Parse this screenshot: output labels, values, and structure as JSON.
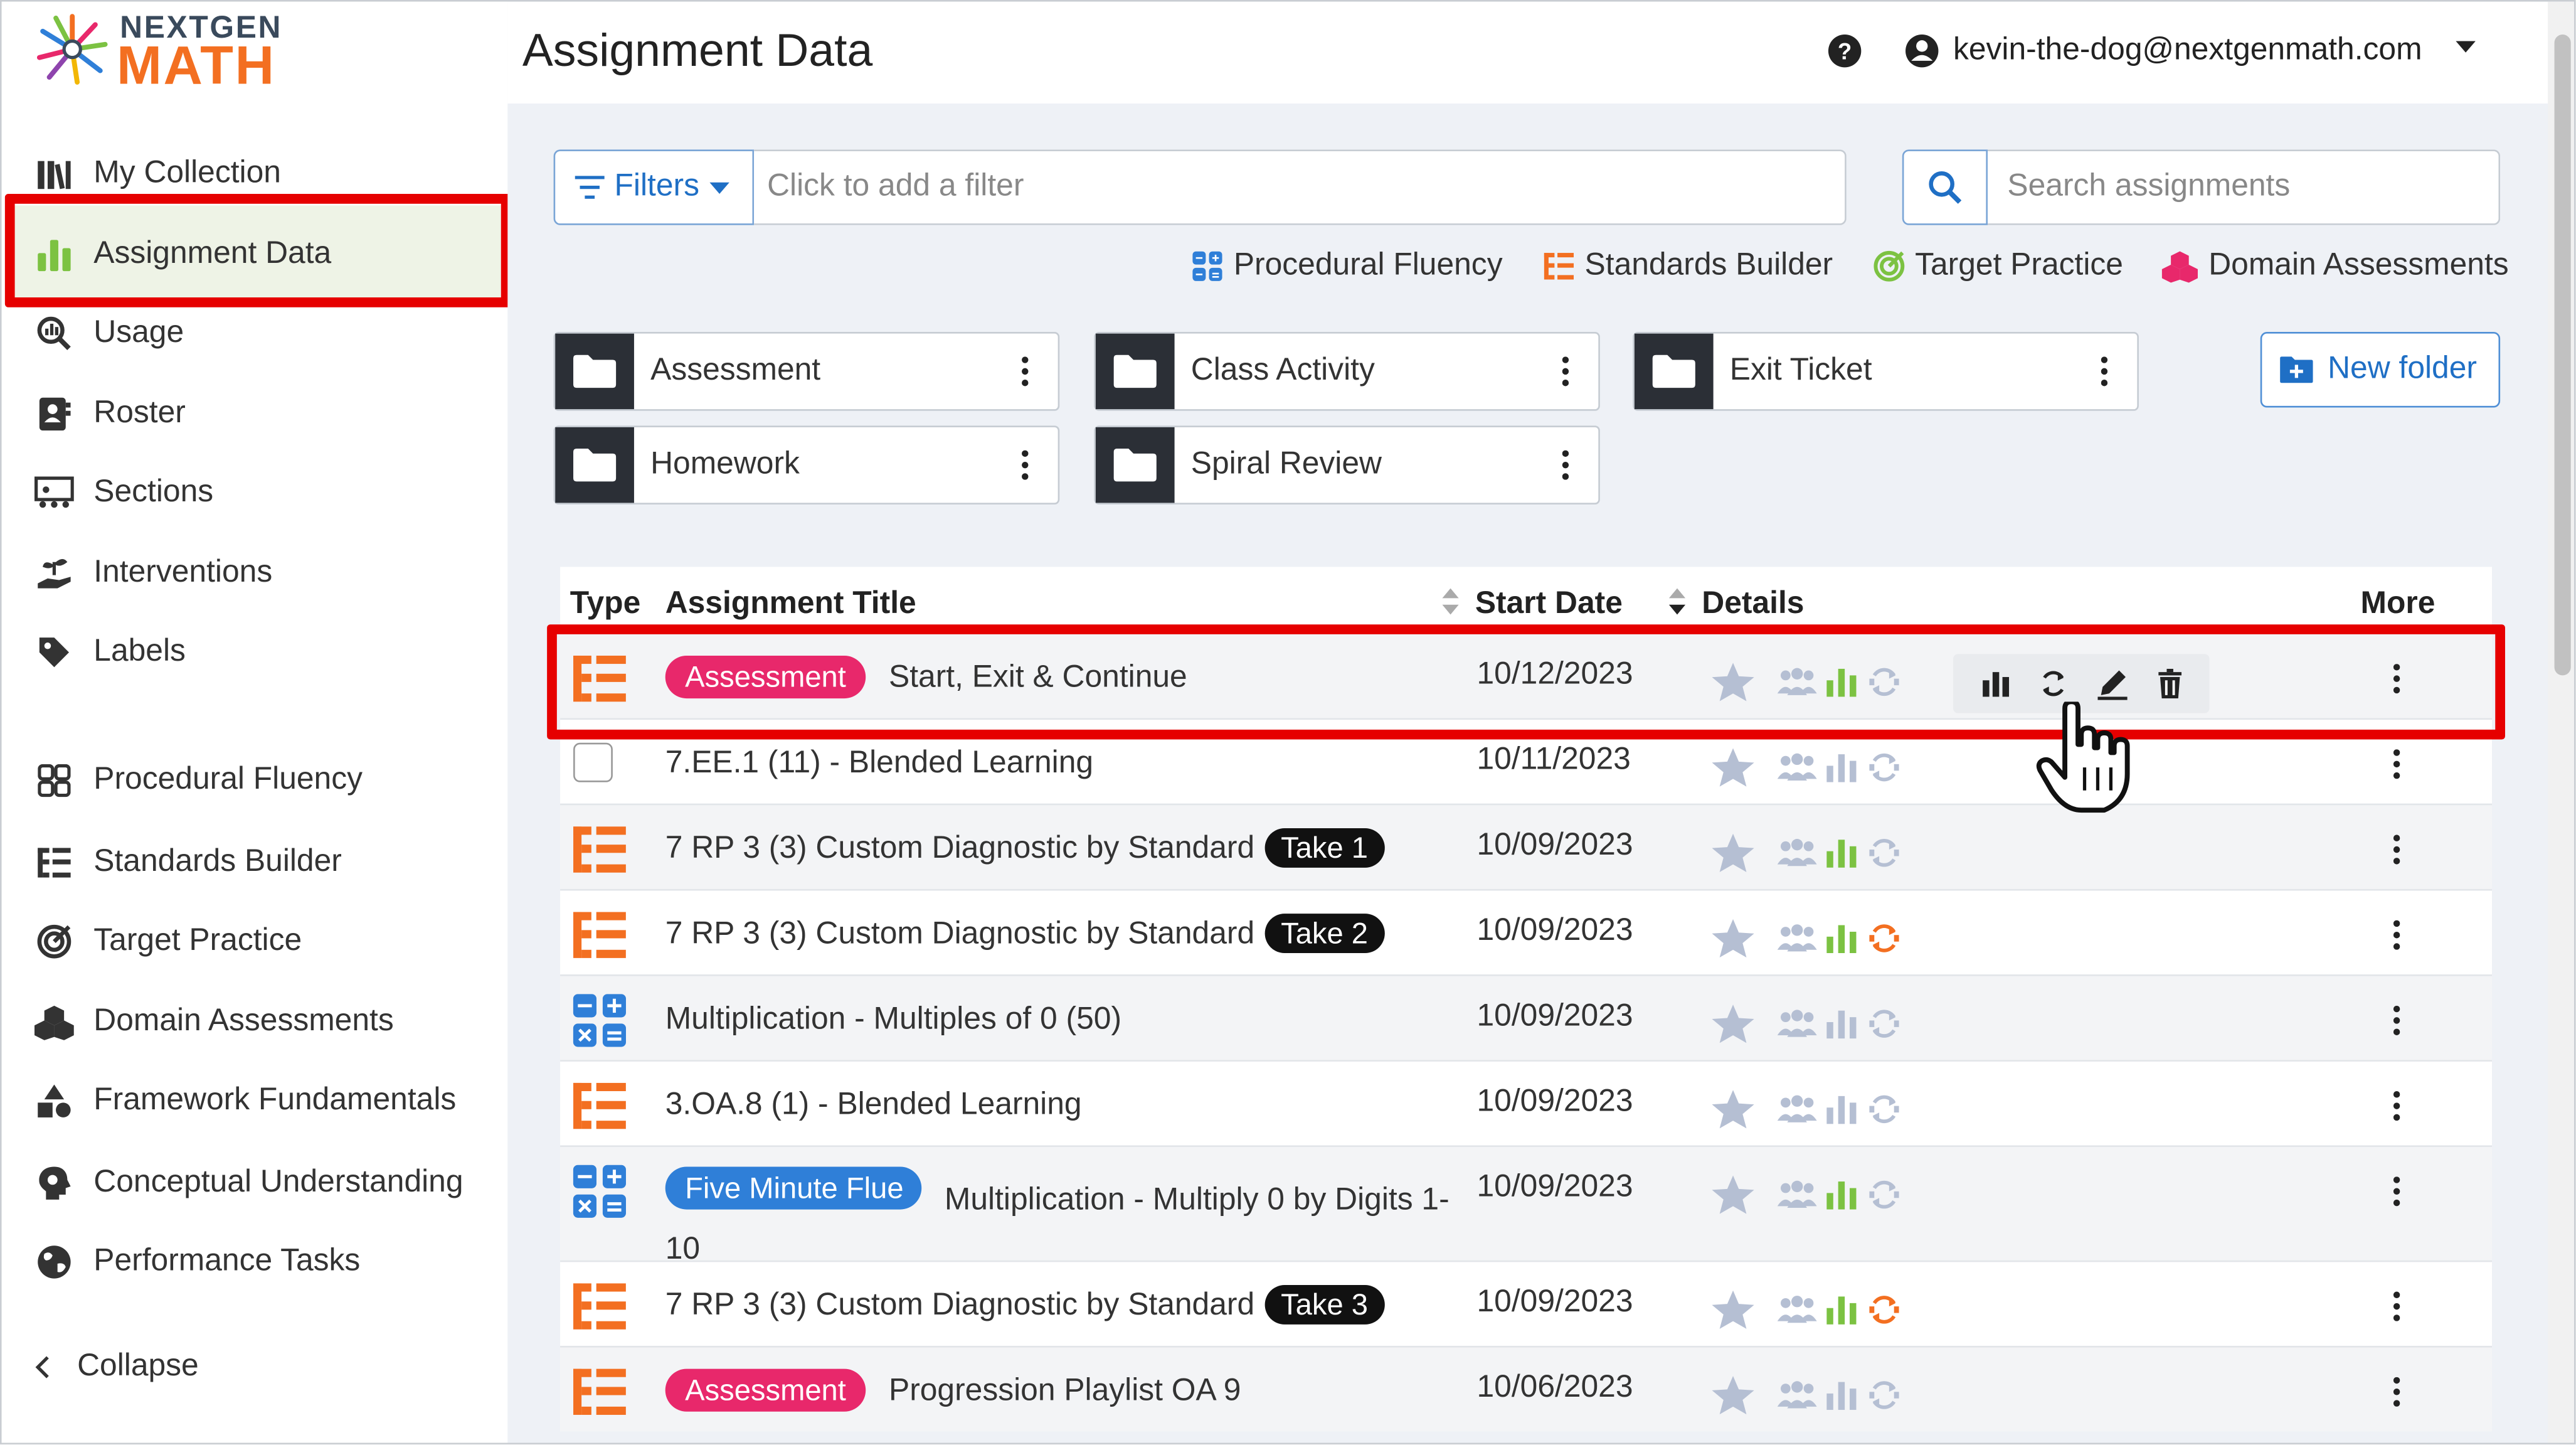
{
  "brand": {
    "line1": "NEXTGEN",
    "line2": "MATH"
  },
  "sidebar": {
    "items": [
      {
        "label": "My Collection",
        "icon": "books-icon"
      },
      {
        "label": "Assignment Data",
        "icon": "bar-chart-icon",
        "active": true
      },
      {
        "label": "Usage",
        "icon": "magnify-chart-icon"
      },
      {
        "label": "Roster",
        "icon": "roster-icon"
      },
      {
        "label": "Sections",
        "icon": "sections-icon"
      },
      {
        "label": "Interventions",
        "icon": "hand-plant-icon"
      },
      {
        "label": "Labels",
        "icon": "tag-icon"
      },
      {
        "label": "Procedural Fluency",
        "icon": "calculator-icon"
      },
      {
        "label": "Standards Builder",
        "icon": "list-tree-icon"
      },
      {
        "label": "Target Practice",
        "icon": "target-icon"
      },
      {
        "label": "Domain Assessments",
        "icon": "cubes-icon"
      },
      {
        "label": "Framework Fundamentals",
        "icon": "shapes-icon"
      },
      {
        "label": "Conceptual Understanding",
        "icon": "brain-icon"
      },
      {
        "label": "Performance Tasks",
        "icon": "globe-icon"
      }
    ],
    "collapse_label": "Collapse"
  },
  "header": {
    "title": "Assignment Data",
    "user_email": "kevin-the-dog@nextgenmath.com"
  },
  "filters": {
    "button_label": "Filters",
    "placeholder": "Click to add a filter"
  },
  "search": {
    "placeholder": "Search assignments"
  },
  "quick_links": [
    {
      "label": "Procedural Fluency",
      "color": "#2f7fd8"
    },
    {
      "label": "Standards Builder",
      "color": "#f36f21"
    },
    {
      "label": "Target Practice",
      "color": "#7cc242"
    },
    {
      "label": "Domain Assessments",
      "color": "#e8286b"
    }
  ],
  "folders": [
    {
      "label": "Assessment"
    },
    {
      "label": "Class Activity"
    },
    {
      "label": "Exit Ticket"
    },
    {
      "label": "Homework"
    },
    {
      "label": "Spiral Review"
    }
  ],
  "new_folder_label": "New folder",
  "table": {
    "headers": {
      "type": "Type",
      "title": "Assignment Title",
      "start_date": "Start Date",
      "details": "Details",
      "more": "More"
    },
    "rows": [
      {
        "type": "standards",
        "badge": "Assessment",
        "badge_color": "pink",
        "title": "Start, Exit & Continue",
        "date": "10/12/2023",
        "bars_green": true,
        "refresh_orange": false,
        "hover": true
      },
      {
        "type": "checkbox",
        "title": "7.EE.1 (11) - Blended Learning",
        "date": "10/11/2023",
        "bars_green": false,
        "refresh_orange": false
      },
      {
        "type": "standards",
        "title": "7 RP 3 (3) Custom Diagnostic by Standard",
        "take": "Take 1",
        "date": "10/09/2023",
        "bars_green": true,
        "refresh_orange": false
      },
      {
        "type": "standards",
        "title": "7 RP 3 (3) Custom Diagnostic by Standard",
        "take": "Take 2",
        "date": "10/09/2023",
        "bars_green": true,
        "refresh_orange": true
      },
      {
        "type": "procedural",
        "title": "Multiplication - Multiples of 0 (50)",
        "date": "10/09/2023",
        "bars_green": false,
        "refresh_orange": false
      },
      {
        "type": "standards",
        "title": "3.OA.8 (1) - Blended Learning",
        "date": "10/09/2023",
        "bars_green": false,
        "refresh_orange": false
      },
      {
        "type": "procedural",
        "badge": "Five Minute Flue",
        "badge_color": "blue",
        "title": "Multiplication - Multiply 0 by Digits 1-10",
        "date": "10/09/2023",
        "bars_green": true,
        "refresh_orange": false
      },
      {
        "type": "standards",
        "title": "7 RP 3 (3) Custom Diagnostic by Standard",
        "take": "Take 3",
        "date": "10/09/2023",
        "bars_green": true,
        "refresh_orange": true
      },
      {
        "type": "standards",
        "badge": "Assessment",
        "badge_color": "pink",
        "title": "Progression Playlist OA 9",
        "date": "10/06/2023",
        "bars_green": false,
        "refresh_orange": false
      }
    ]
  },
  "colors": {
    "accent_blue": "#1f6fc5",
    "orange": "#f36f21",
    "green": "#7cc242",
    "pink": "#e8286b",
    "highlight_red": "#e60000"
  }
}
